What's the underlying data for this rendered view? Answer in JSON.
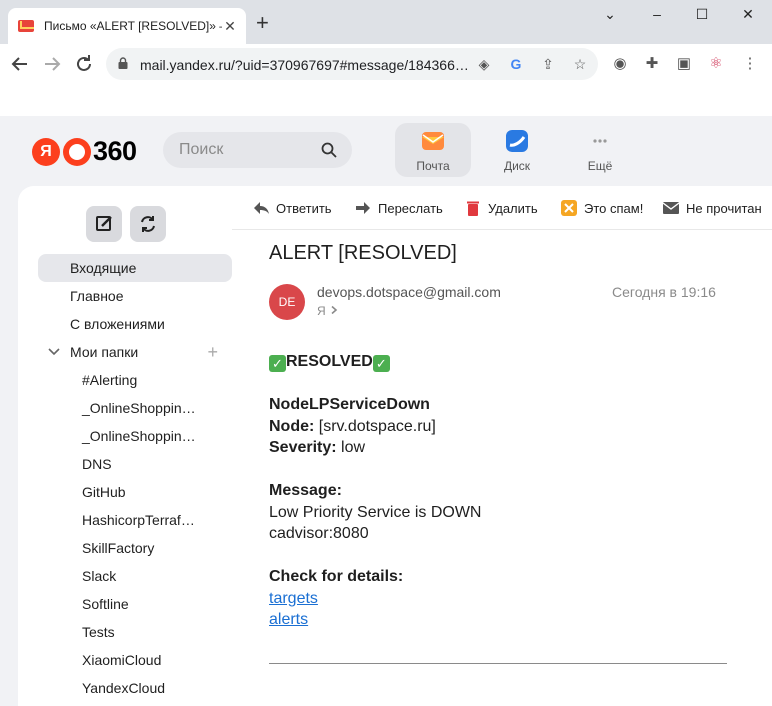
{
  "browser": {
    "tab_title": "Письмо «ALERT [RESOLVED]» —",
    "tab_close": "✕",
    "new_tab": "+",
    "url": "mail.yandex.ru/?uid=370967697#message/184366…",
    "window_controls": [
      "⌄",
      "–",
      "☐",
      "✕"
    ]
  },
  "header": {
    "logo_ya": "Я",
    "logo_num": "360",
    "search_placeholder": "Поиск",
    "services": [
      {
        "label": "Почта",
        "icon": "mail-icon"
      },
      {
        "label": "Диск",
        "icon": "disk-icon"
      },
      {
        "label": "Ещё",
        "icon": "more-icon"
      }
    ]
  },
  "sidebar": {
    "folders": [
      {
        "label": "Входящие",
        "level": 0
      },
      {
        "label": "Главное",
        "level": 0
      },
      {
        "label": "С вложениями",
        "level": 0
      },
      {
        "label": "Мои папки",
        "level": 0
      },
      {
        "label": "#Alerting",
        "level": 1
      },
      {
        "label": "_OnlineShoppin…",
        "level": 1
      },
      {
        "label": "_OnlineShoppin…",
        "level": 1
      },
      {
        "label": "DNS",
        "level": 1
      },
      {
        "label": "GitHub",
        "level": 1
      },
      {
        "label": "HashicorpTerraf…",
        "level": 1
      },
      {
        "label": "SkillFactory",
        "level": 1
      },
      {
        "label": "Slack",
        "level": 1
      },
      {
        "label": "Softline",
        "level": 1
      },
      {
        "label": "Tests",
        "level": 1
      },
      {
        "label": "XiaomiCloud",
        "level": 1
      },
      {
        "label": "YandexCloud",
        "level": 1
      }
    ]
  },
  "actions": {
    "reply": "Ответить",
    "forward": "Переслать",
    "delete": "Удалить",
    "spam": "Это спам!",
    "unread": "Не прочитан"
  },
  "message": {
    "subject": "ALERT [RESOLVED]",
    "avatar": "DE",
    "sender": "devops.dotspace@gmail.com",
    "recipient": "Я",
    "date": "Сегодня в 19:16",
    "status": "RESOLVED",
    "alertname": "NodeLPServiceDown",
    "node_label": "Node:",
    "node_value": "[srv.dotspace.ru]",
    "severity_label": "Severity:",
    "severity_value": "low",
    "message_label": "Message:",
    "message_line1": "Low Priority Service is DOWN",
    "message_line2": "cadvisor:8080",
    "details_label": "Check for details:",
    "link_targets": "targets",
    "link_alerts": "alerts"
  }
}
